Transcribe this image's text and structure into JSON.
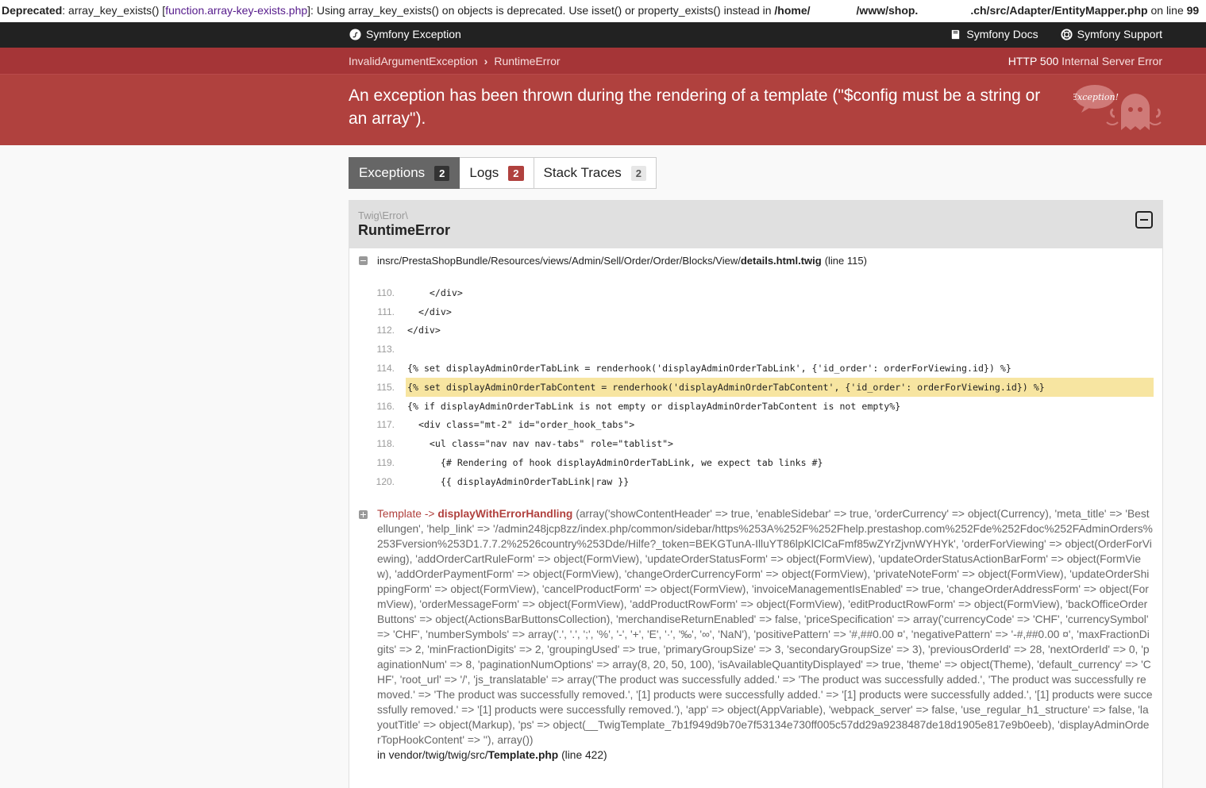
{
  "deprecated": {
    "label": "Deprecated",
    "prefix": ": array_key_exists() [",
    "link": "function.array-key-exists.php",
    "message": "]: Using array_key_exists() on objects is deprecated. Use isset() or property_exists() instead in ",
    "path_part1": "/home/",
    "path_part2": "/www/shop.",
    "path_part3": ".ch/src/Adapter/EntityMapper.php",
    "on_line": " on line ",
    "line": "99"
  },
  "topbar": {
    "brand": "Symfony Exception",
    "docs": "Symfony Docs",
    "support": "Symfony Support"
  },
  "breadcrumb": {
    "items": [
      "InvalidArgumentException",
      "RuntimeError"
    ],
    "status_code": "HTTP 500",
    "status_text": "Internal Server Error"
  },
  "exception": {
    "message": "An exception has been thrown during the rendering of a template (\"$config must be a string or an array\").",
    "logo_text": "Exception!"
  },
  "tabs": [
    {
      "label": "Exceptions",
      "count": "2"
    },
    {
      "label": "Logs",
      "count": "2"
    },
    {
      "label": "Stack Traces",
      "count": "2"
    }
  ],
  "panel": {
    "namespace": "Twig\\Error\\",
    "class": "RuntimeError",
    "location_prefix": "in ",
    "location_path": "src/PrestaShopBundle/Resources/views/Admin/Sell/Order/Order/Blocks/View/",
    "location_file": "details.html.twig",
    "location_line": "(line 115)",
    "code_lines": [
      {
        "num": "110.",
        "text": "    </div>"
      },
      {
        "num": "111.",
        "text": "  </div>"
      },
      {
        "num": "112.",
        "text": "</div>"
      },
      {
        "num": "113.",
        "text": ""
      },
      {
        "num": "114.",
        "text": "{% set displayAdminOrderTabLink = renderhook('displayAdminOrderTabLink', {'id_order': orderForViewing.id}) %}"
      },
      {
        "num": "115.",
        "text": "{% set displayAdminOrderTabContent = renderhook('displayAdminOrderTabContent', {'id_order': orderForViewing.id}) %}"
      },
      {
        "num": "116.",
        "text": "{% if displayAdminOrderTabLink is not empty or displayAdminOrderTabContent is not empty%}"
      },
      {
        "num": "117.",
        "text": "  <div class=\"mt-2\" id=\"order_hook_tabs\">"
      },
      {
        "num": "118.",
        "text": "    <ul class=\"nav nav nav-tabs\" role=\"tablist\">"
      },
      {
        "num": "119.",
        "text": "      {# Rendering of hook displayAdminOrderTabLink, we expect tab links #}"
      },
      {
        "num": "120.",
        "text": "      {{ displayAdminOrderTabLink|raw }}"
      }
    ]
  },
  "frame": {
    "class": "Template",
    "arrow": " -> ",
    "function": "displayWithErrorHandling",
    "args": "(array('showContentHeader' => true, 'enableSidebar' => true, 'orderCurrency' => object(Currency), 'meta_title' => 'Bestellungen', 'help_link' => '/admin248jcp8zz/index.php/common/sidebar/https%253A%252F%252Fhelp.prestashop.com%252Fde%252Fdoc%252FAdminOrders%253Fversion%253D1.7.7.2%2526country%253Dde/Hilfe?_token=BEKGTunA-IlluYT86lpKlClCaFmf85wZYrZjvnWYHYk', 'orderForViewing' => object(OrderForViewing), 'addOrderCartRuleForm' => object(FormView), 'updateOrderStatusForm' => object(FormView), 'updateOrderStatusActionBarForm' => object(FormView), 'addOrderPaymentForm' => object(FormView), 'changeOrderCurrencyForm' => object(FormView), 'privateNoteForm' => object(FormView), 'updateOrderShippingForm' => object(FormView), 'cancelProductForm' => object(FormView), 'invoiceManagementIsEnabled' => true, 'changeOrderAddressForm' => object(FormView), 'orderMessageForm' => object(FormView), 'addProductRowForm' => object(FormView), 'editProductRowForm' => object(FormView), 'backOfficeOrderButtons' => object(ActionsBarButtonsCollection), 'merchandiseReturnEnabled' => false, 'priceSpecification' => array('currencyCode' => 'CHF', 'currencySymbol' => 'CHF', 'numberSymbols' => array('.', '.', ';', '%', '-', '+', 'E', '·', '‰', '∞', 'NaN'), 'positivePattern' => '#,##0.00 ¤', 'negativePattern' => '-#,##0.00 ¤', 'maxFractionDigits' => 2, 'minFractionDigits' => 2, 'groupingUsed' => true, 'primaryGroupSize' => 3, 'secondaryGroupSize' => 3), 'previousOrderId' => 28, 'nextOrderId' => 0, 'paginationNum' => 8, 'paginationNumOptions' => array(8, 20, 50, 100), 'isAvailableQuantityDisplayed' => true, 'theme' => object(Theme), 'default_currency' => 'CHF', 'root_url' => '/', 'js_translatable' => array('The product was successfully added.' => 'The product was successfully added.', 'The product was successfully removed.' => 'The product was successfully removed.', '[1] products were successfully added.' => '[1] products were successfully added.', '[1] products were successfully removed.' => '[1] products were successfully removed.'), 'app' => object(AppVariable), 'webpack_server' => false, 'use_regular_h1_structure' => false, 'layoutTitle' => object(Markup), 'ps' => object(__TwigTemplate_7b1f949d9b70e7f53134e730ff005c57dd29a9238487de18d1905e817e9b0eeb), 'displayAdminOrderTopHookContent' => ''), array())",
    "loc_prefix": "in vendor/twig/twig/src/",
    "loc_file": "Template.php",
    "loc_line": "(line 422)"
  },
  "colors": {
    "header_red": "#b0413e",
    "crumb_red": "#a53537",
    "dark": "#222222",
    "highlight": "#f7e5a1"
  }
}
